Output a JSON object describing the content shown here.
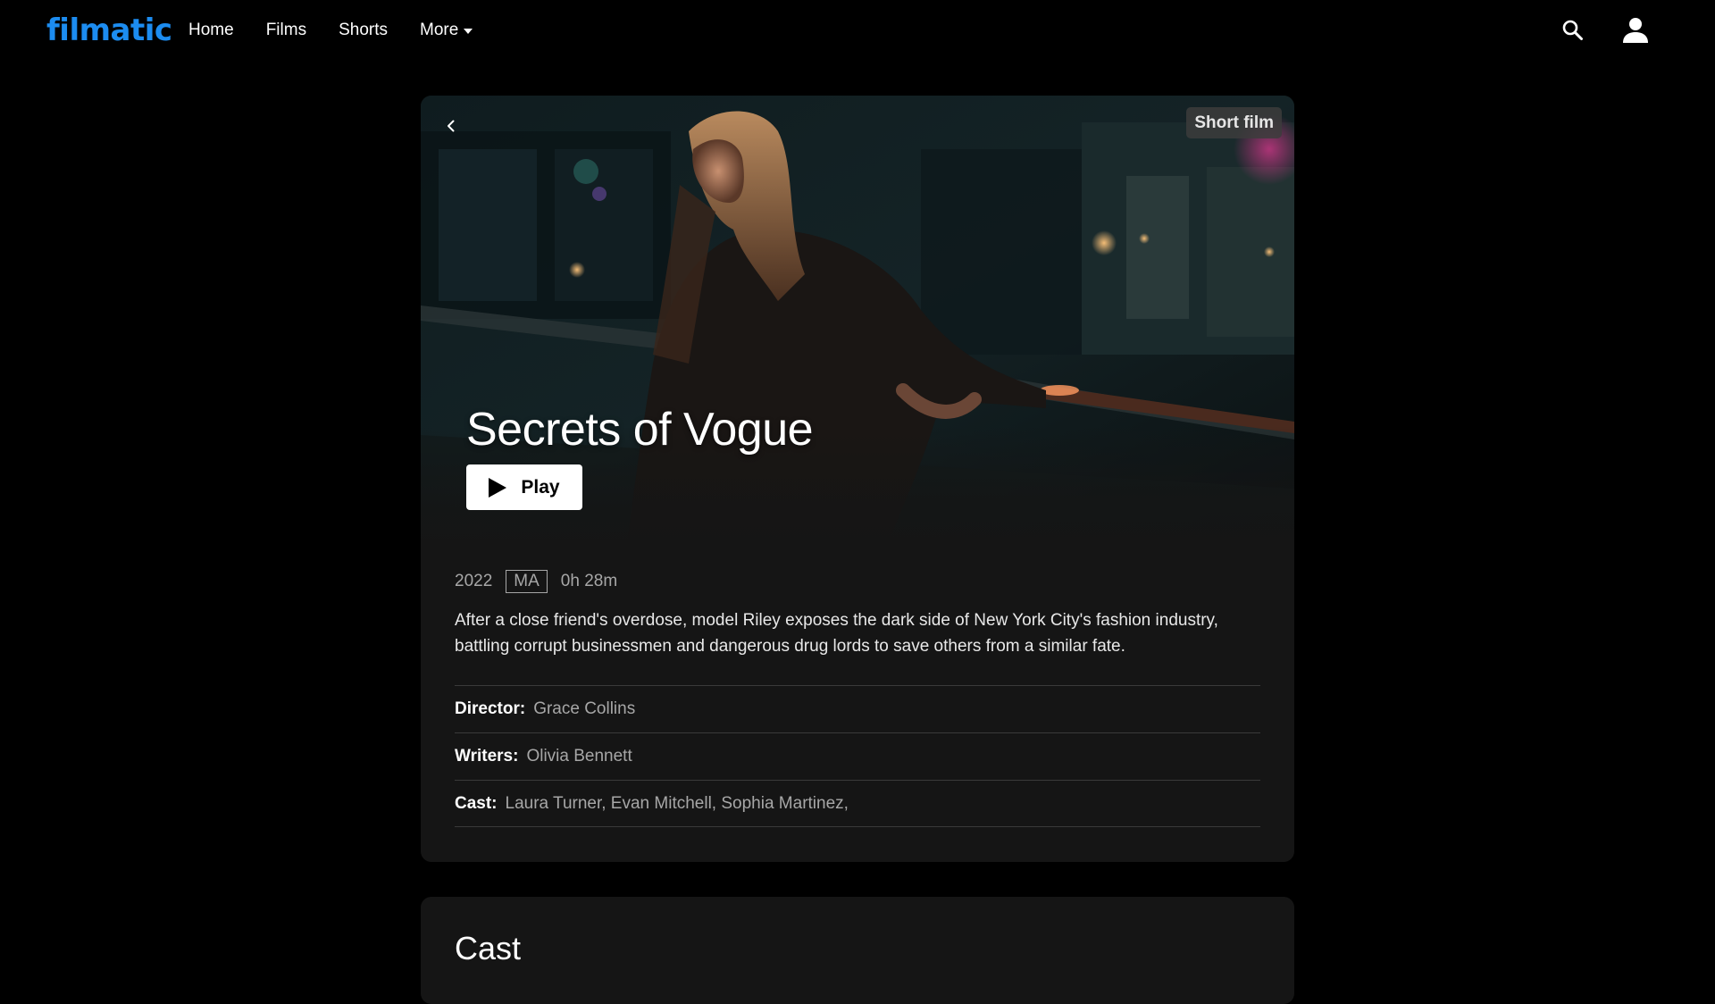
{
  "app": {
    "logo": "filmatic",
    "brand_color": "#1c8cf0"
  },
  "nav": {
    "items": [
      {
        "label": "Home"
      },
      {
        "label": "Films"
      },
      {
        "label": "Shorts"
      },
      {
        "label": "More"
      }
    ],
    "icons": [
      "search-icon",
      "user-icon"
    ]
  },
  "film": {
    "badge": "Short film",
    "title": "Secrets of Vogue",
    "play_label": "Play",
    "year": "2022",
    "rating": "MA",
    "duration": "0h 28m",
    "description": "After a close friend's overdose, model Riley exposes the dark side of New York City's fashion industry, battling corrupt businessmen and dangerous drug lords to save others from a similar fate.",
    "credits": [
      {
        "label": "Director:",
        "value": "Grace Collins"
      },
      {
        "label": "Writers:",
        "value": "Olivia Bennett"
      },
      {
        "label": "Cast:",
        "value": "Laura Turner, Evan Mitchell, Sophia Martinez,"
      }
    ]
  },
  "cast_section": {
    "heading": "Cast"
  },
  "colors": {
    "background": "#000000",
    "card": "#151515",
    "muted_text": "#a7a7a7",
    "divider": "#3a3a3a"
  }
}
